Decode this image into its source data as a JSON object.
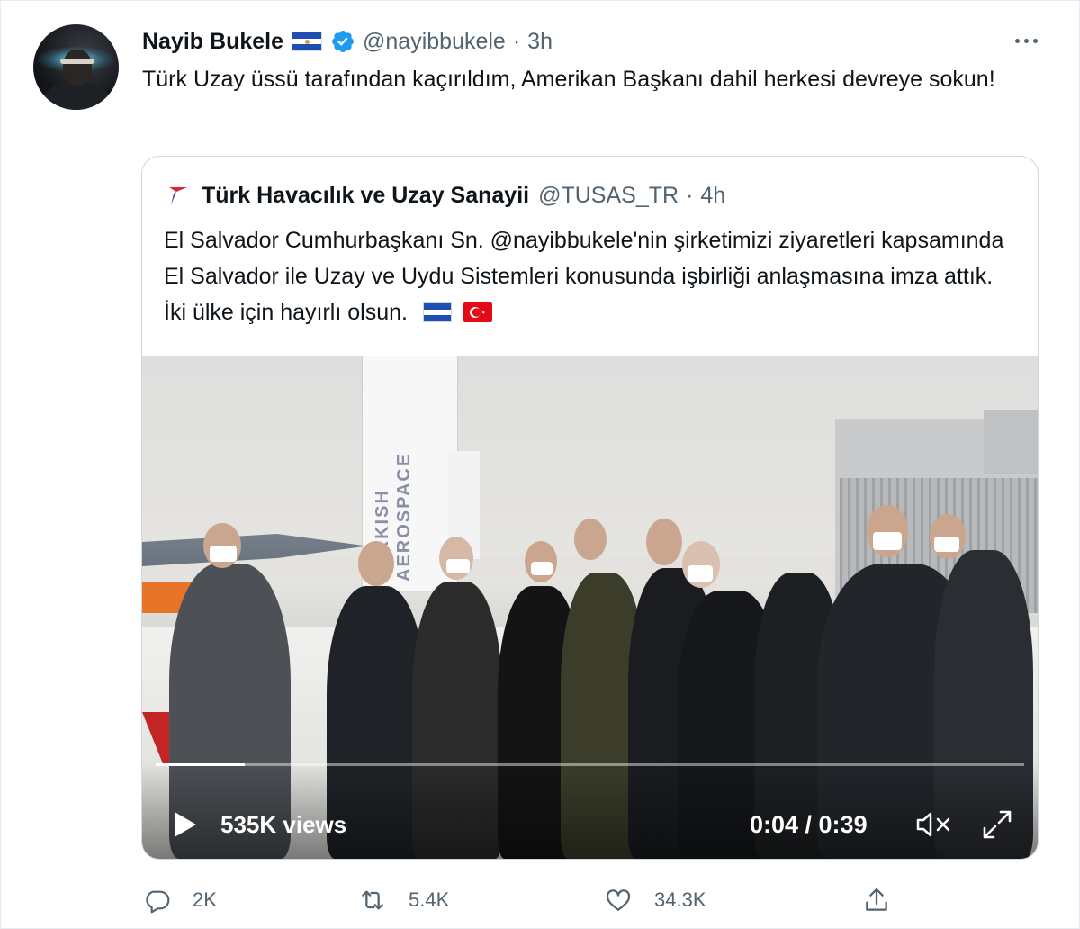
{
  "author": {
    "name": "Nayib Bukele",
    "handle": "@nayibbukele",
    "separator": "·",
    "time": "3h",
    "verified": true,
    "flag": "el-salvador-flag"
  },
  "tweet": {
    "text": "Türk Uzay üssü tarafından kaçırıldım, Amerikan Başkanı dahil herkesi devreye sokun!"
  },
  "quote": {
    "name": "Türk Havacılık ve Uzay Sanayii",
    "handle": "@TUSAS_TR",
    "separator": "·",
    "time": "4h",
    "text": "El Salvador Cumhurbaşkanı Sn. @nayibbukele'nin şirketimizi ziyaretleri kapsamında El Salvador ile Uzay ve Uydu Sistemleri konusunda işbirliği anlaşmasına imza attık. İki ülke için hayırlı olsun.",
    "flags": [
      "el-salvador-flag",
      "turkey-flag"
    ],
    "video": {
      "views": "535K views",
      "time": "0:04 / 0:39",
      "progress": 0.103,
      "banner_text": "TURKISH AEROSPACE"
    }
  },
  "actions": {
    "replies": "2K",
    "retweets": "5.4K",
    "likes": "34.3K"
  },
  "colors": {
    "text": "#0f1419",
    "secondary": "#536471",
    "verified": "#1d9bf0",
    "border": "#cfd9de"
  }
}
